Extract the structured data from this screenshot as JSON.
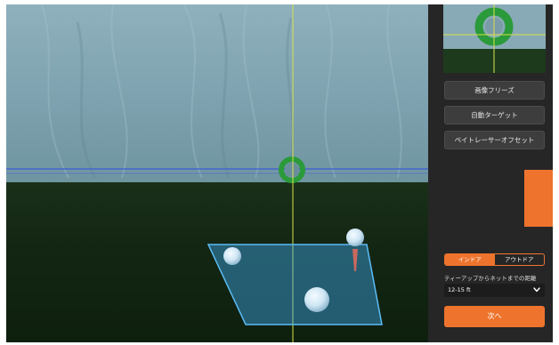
{
  "sidebar": {
    "buttons": {
      "freeze_image": "画像フリーズ",
      "auto_target": "自動ターゲット",
      "tee_tracer_offset": "ペイトレーサーオフセット"
    },
    "environment_toggle": {
      "options": [
        "インドア",
        "アウトドア"
      ],
      "selected": "インドア"
    },
    "distance": {
      "label": "ティーアップからネットまでの距離",
      "value": "12-15 ft"
    },
    "next_button": "次へ"
  },
  "colors": {
    "accent": "#ee742d",
    "sidebar_bg": "#262626",
    "button_bg": "#3d3d3d",
    "crosshair": "#d9e24a",
    "target_ring": "#2a9a3a",
    "hitting_zone": "#3da6e8"
  },
  "icons": {
    "dropdown": "chevron-down-icon"
  }
}
